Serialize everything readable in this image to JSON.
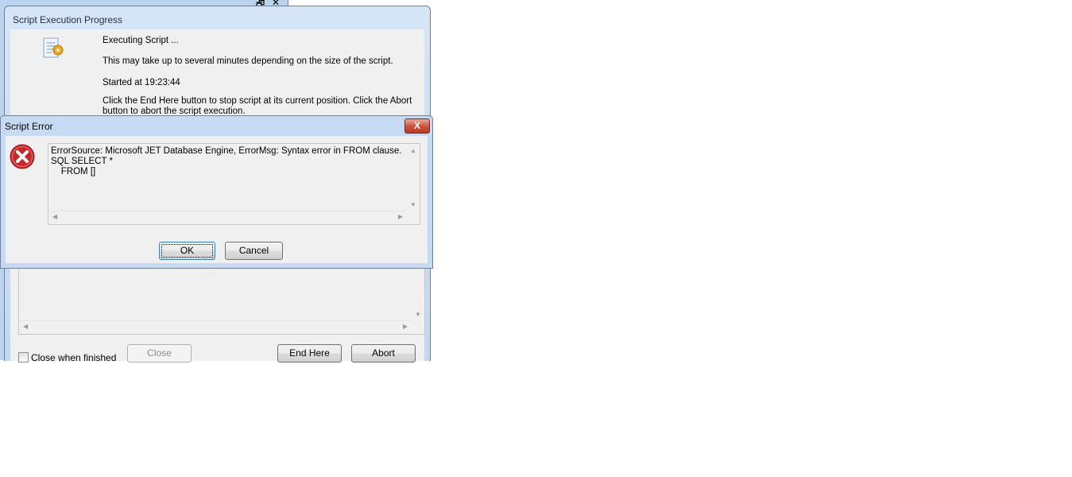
{
  "background_window": {
    "controls": [
      "_",
      "🗗",
      "✕"
    ]
  },
  "progress_dialog": {
    "title": "Script Execution Progress",
    "icon": "script-gear-icon",
    "line1": "Executing Script ...",
    "line2": "This may take up to several minutes depending on the size of the script.",
    "started": "Started at 19:23:44",
    "hint1": "Click the End Here button to stop script at its current position. Click the Abort",
    "hint2": "button to abort the script execution.",
    "close_when_finished": "Close when finished",
    "close_when_finished_checked": false,
    "close_button": "Close",
    "end_here_button": "End Here",
    "abort_button": "Abort"
  },
  "error_dialog": {
    "title": "Script Error",
    "icon": "error-icon",
    "message_lines": [
      "ErrorSource: Microsoft JET Database Engine, ErrorMsg: Syntax error in FROM clause.",
      "SQL SELECT *",
      "    FROM []"
    ],
    "ok_button": "OK",
    "cancel_button": "Cancel",
    "close_glyph": "X"
  }
}
